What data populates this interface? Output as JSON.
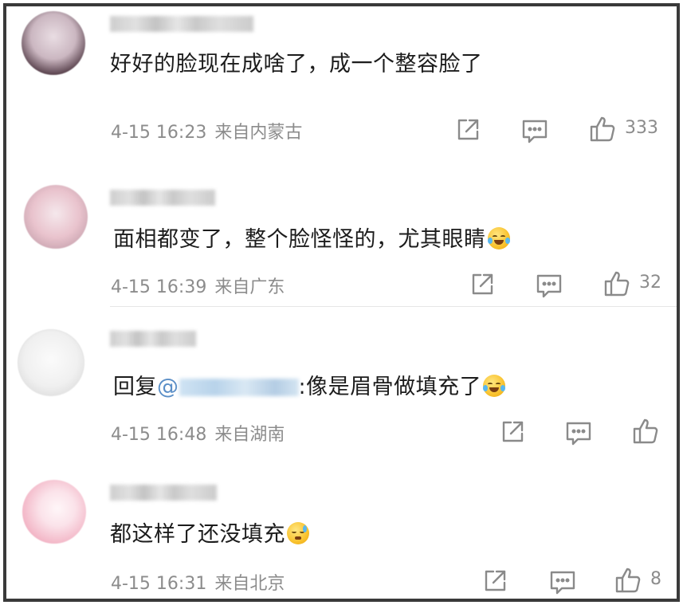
{
  "comments": [
    {
      "text": "好好的脸现在成啥了，成一个整容脸了",
      "time": "4-15 16:23",
      "location": "来自内蒙古",
      "likes": "333",
      "avatar_colors": [
        "#e9dde3",
        "#b79aa6",
        "#5e4752"
      ]
    },
    {
      "text": "面相都变了，整个脸怪怪的，尤其眼睛",
      "emoji": "laugh-crying-emoji",
      "time": "4-15 16:39",
      "location": "来自广东",
      "likes": "32",
      "avatar_colors": [
        "#f5e8ec",
        "#e9c3cd",
        "#c5a0ac"
      ]
    },
    {
      "reply_prefix": "回复",
      "mention_at": "@",
      "text": ":像是眉骨做填充了",
      "emoji": "laugh-crying-emoji",
      "time": "4-15 16:48",
      "location": "来自湖南",
      "likes": "",
      "avatar_colors": [
        "#f7f7f7",
        "#d9d9d9",
        "#9b9b9b"
      ]
    },
    {
      "text": "都这样了还没填充",
      "emoji": "sweat-emoji",
      "time": "4-15 16:31",
      "location": "来自北京",
      "likes": "8",
      "avatar_colors": [
        "#fbe3ea",
        "#f3b8c8",
        "#e68aa6"
      ]
    }
  ],
  "colors": {
    "text": "#1c1c1c",
    "meta": "#8c8c8c",
    "icon": "#8a8a8a",
    "mention": "#5b8fc7",
    "frame": "#3a3a3a"
  },
  "icons": {
    "share": "share-icon",
    "comment": "comment-icon",
    "like": "thumbs-up-icon"
  }
}
